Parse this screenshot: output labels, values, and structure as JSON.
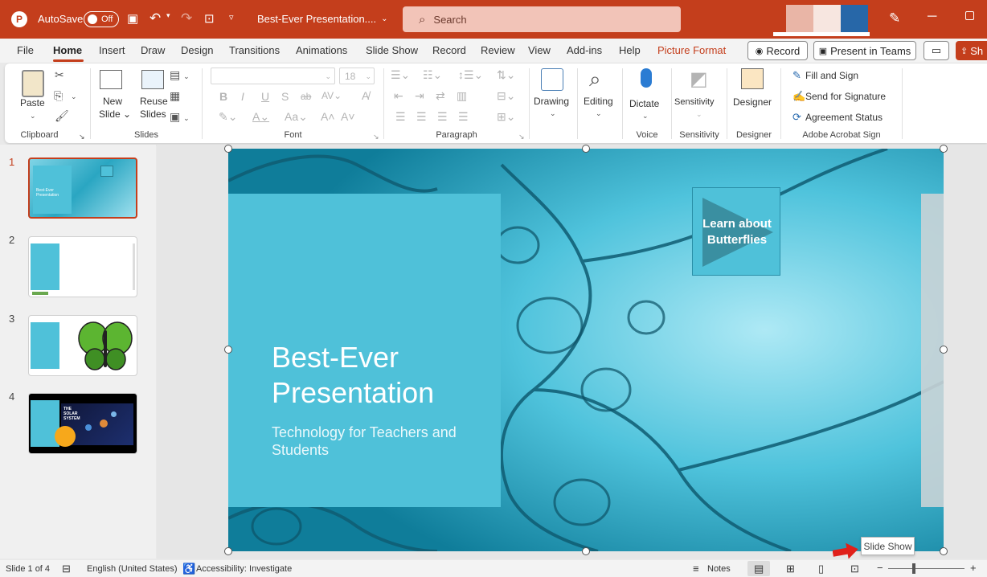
{
  "titlebar": {
    "autosave_label": "AutoSave",
    "autosave_state": "Off",
    "doc_title": "Best-Ever Presentation....",
    "search_placeholder": "Search"
  },
  "tabs": [
    "File",
    "Home",
    "Insert",
    "Draw",
    "Design",
    "Transitions",
    "Animations",
    "Slide Show",
    "Record",
    "Review",
    "View",
    "Add-ins",
    "Help",
    "Picture Format"
  ],
  "tab_actions": {
    "record": "Record",
    "present_teams": "Present in Teams",
    "share": "Sh"
  },
  "ribbon": {
    "clipboard": {
      "paste": "Paste",
      "label": "Clipboard"
    },
    "slides": {
      "new_slide_1": "New",
      "new_slide_2": "Slide",
      "reuse_1": "Reuse",
      "reuse_2": "Slides",
      "label": "Slides"
    },
    "font": {
      "size": "18",
      "label": "Font"
    },
    "paragraph": {
      "label": "Paragraph"
    },
    "drawing": {
      "label": "Drawing"
    },
    "editing": {
      "label": "Editing"
    },
    "voice": {
      "dictate": "Dictate",
      "label": "Voice"
    },
    "sensitivity": {
      "btn": "Sensitivity",
      "label": "Sensitivity"
    },
    "designer": {
      "btn": "Designer",
      "label": "Designer"
    },
    "acrobat": {
      "fill_sign": "Fill and Sign",
      "send_sig": "Send for Signature",
      "agreement": "Agreement Status",
      "label": "Adobe Acrobat Sign"
    }
  },
  "thumbnails": [
    {
      "num": "1",
      "title": "Best-Ever Presentation"
    },
    {
      "num": "2"
    },
    {
      "num": "3"
    },
    {
      "num": "4",
      "text": "THE SOLAR SYSTEM"
    }
  ],
  "slide": {
    "title_line1": "Best-Ever",
    "title_line2": "Presentation",
    "subtitle_line1": "Technology for Teachers and",
    "subtitle_line2": "Students",
    "button_line1": "Learn about",
    "button_line2": "Butterflies"
  },
  "tooltip": "Slide Show",
  "statusbar": {
    "slide_count": "Slide 1 of 4",
    "language": "English (United States)",
    "accessibility": "Accessibility: Investigate",
    "notes": "Notes"
  },
  "colors": {
    "accent": "#c43e1c",
    "slide_teal": "#4fc1d9",
    "selection": "#c43e1c"
  }
}
